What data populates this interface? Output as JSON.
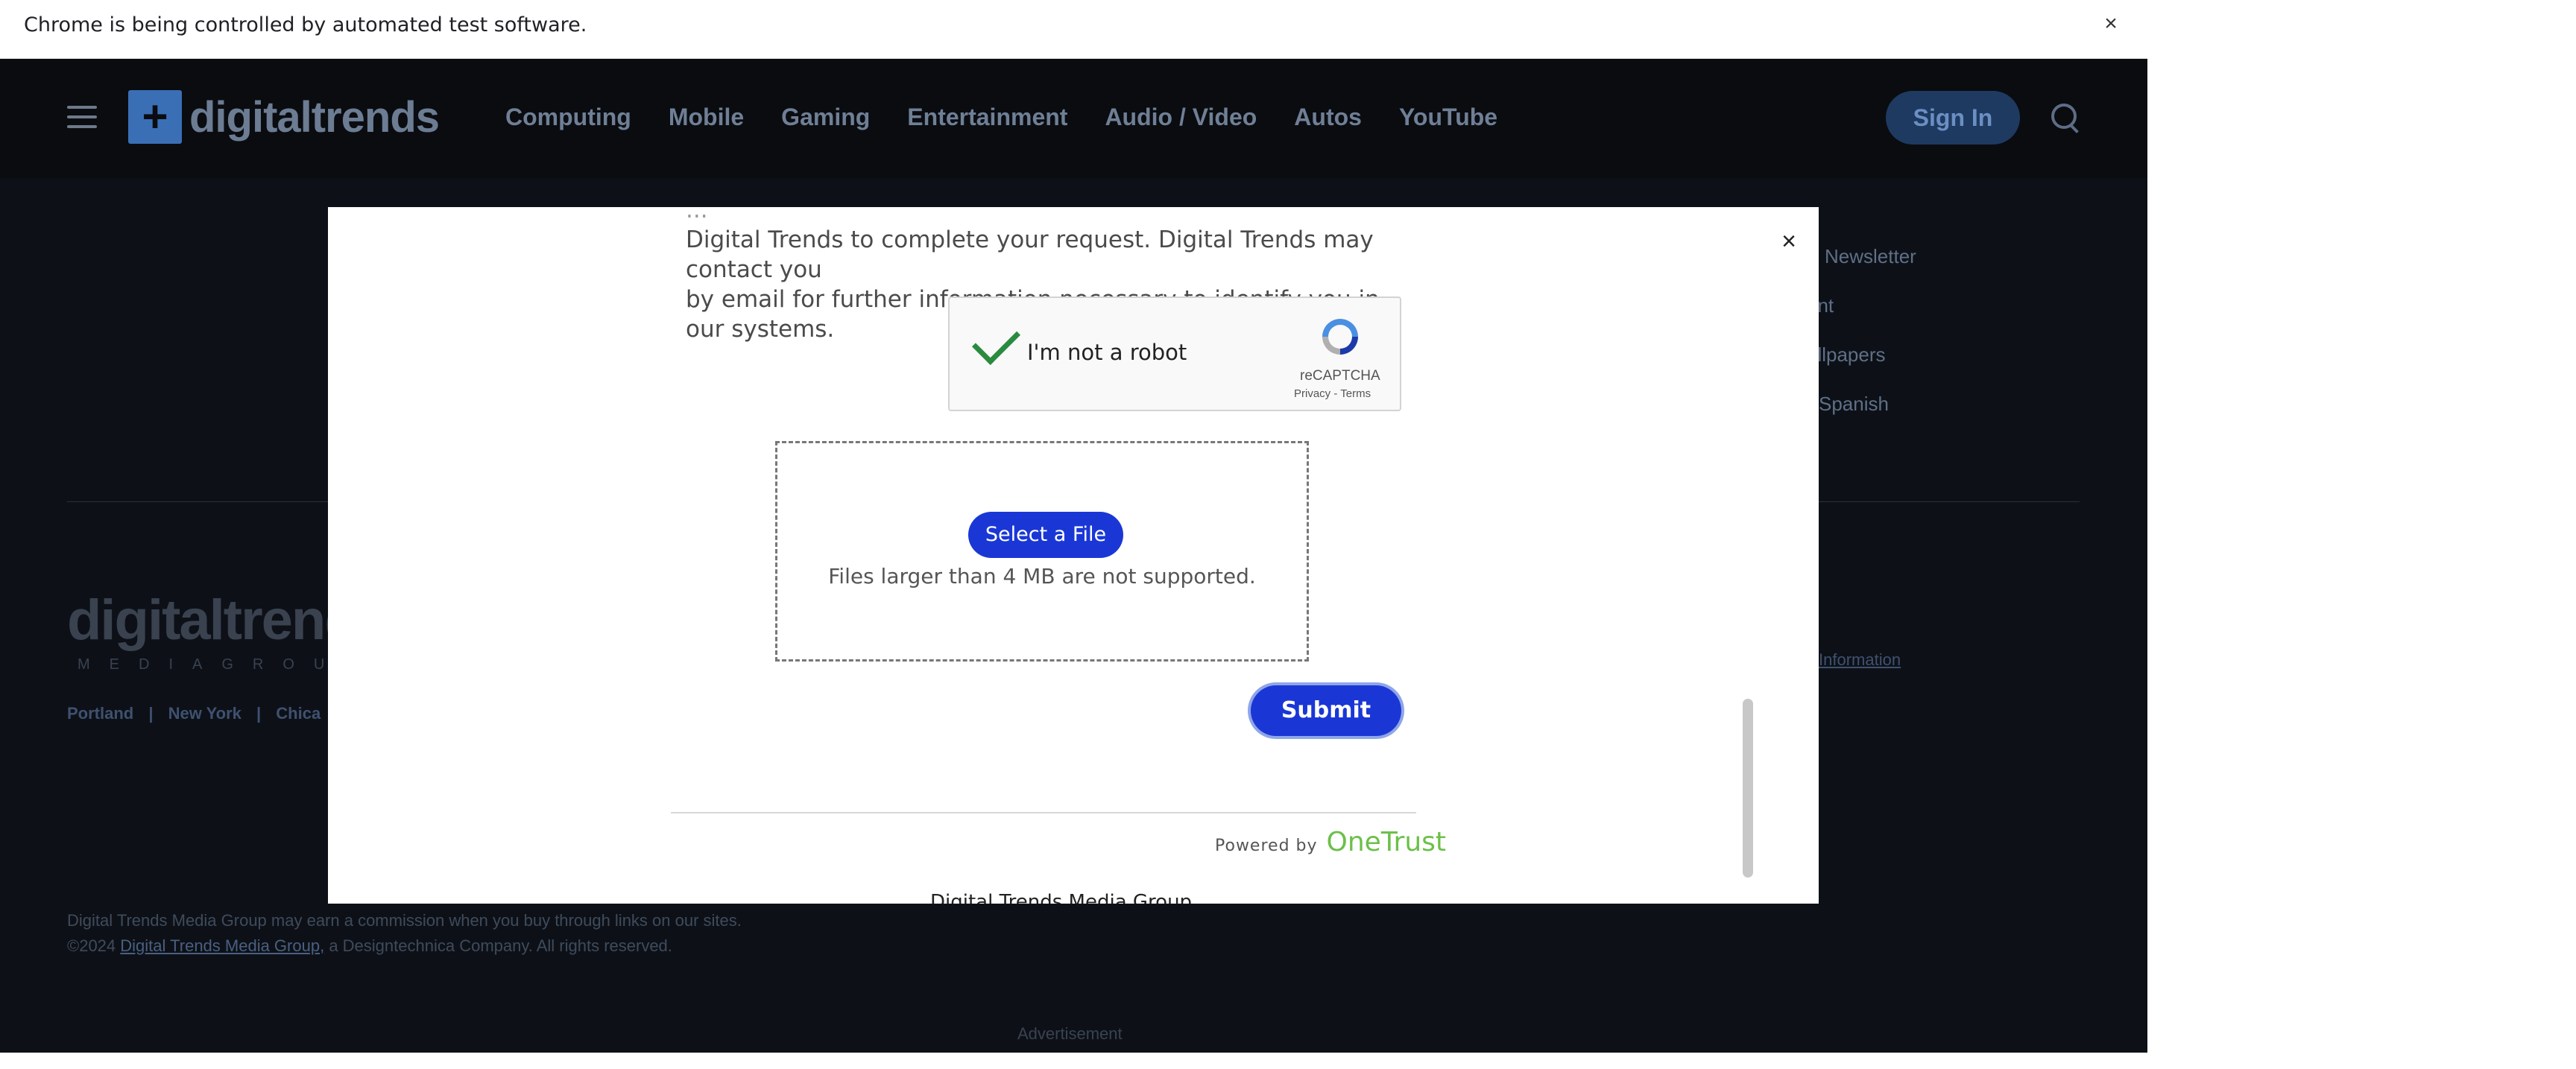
{
  "infobar": {
    "message": "Chrome is being controlled by automated test software.",
    "close": "×"
  },
  "header": {
    "logo_mark": "+",
    "logo_text": "digitaltrends",
    "nav": [
      "Computing",
      "Mobile",
      "Gaming",
      "Entertainment",
      "Audio / Video",
      "Autos",
      "YouTube"
    ],
    "sign_in": "Sign In"
  },
  "side_links": [
    "Newsletter",
    "ent",
    "allpapers",
    "Spanish"
  ],
  "footer": {
    "logo_text": "digitaltrend",
    "logo_sub": "MEDIAGROU",
    "cities": [
      "Portland",
      "|",
      "New York",
      "|",
      "Chica"
    ],
    "privacy_info": "Information",
    "legal_line1": "Digital Trends Media Group may earn a commission when you buy through links on our sites.",
    "legal_prefix": "©2024",
    "legal_link": "Digital Trends Media Group,",
    "legal_suffix": "a Designtechnica Company. All rights reserved.",
    "advertisement": "Advertisement"
  },
  "modal": {
    "close": "×",
    "notice_line0": "...",
    "notice_line1": "Digital Trends to complete your request. Digital Trends may contact you",
    "notice_line2": "by email for further information necessary to identify you in our systems.",
    "recaptcha": {
      "label": "I'm not a robot",
      "brand": "reCAPTCHA",
      "terms": "Privacy - Terms",
      "checked": true
    },
    "select_file": "Select a File",
    "file_note": "Files larger than 4 MB are not supported.",
    "submit": "Submit",
    "powered_by": "Powered by",
    "onetrust": "OneTrust",
    "footer_text": "Digital Trends Media Group"
  }
}
